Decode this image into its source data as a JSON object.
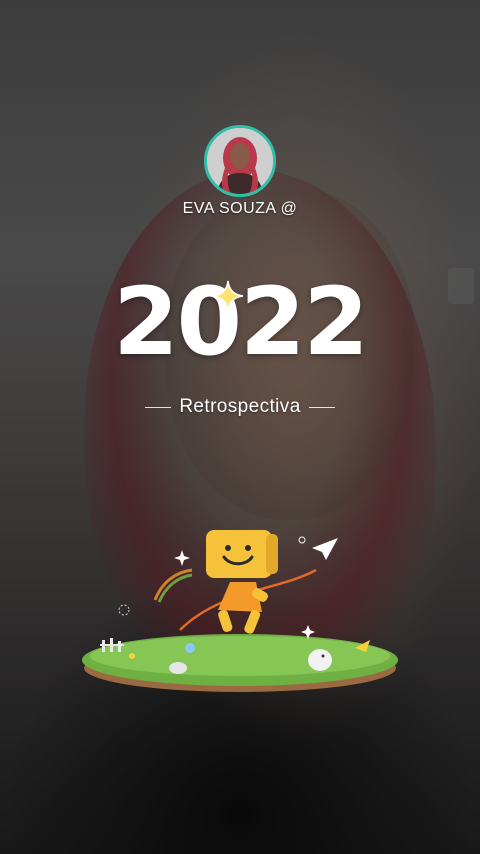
{
  "profile": {
    "username": "EVA SOUZA @",
    "avatar_icon": "profile-photo-avatar",
    "ring_color": "#2fc0a8"
  },
  "hero": {
    "year": "2022",
    "subtitle": "Retrospectiva"
  },
  "icons": {
    "sparkle": "sparkle-icon",
    "paper_plane": "paper-plane-icon",
    "mascot": "box-head-mascot",
    "island": "grass-island"
  },
  "colors": {
    "mascot_head": "#f5c23a",
    "mascot_body": "#f39a2a",
    "grass": "#7bbd4a",
    "soil": "#9a6a42"
  }
}
